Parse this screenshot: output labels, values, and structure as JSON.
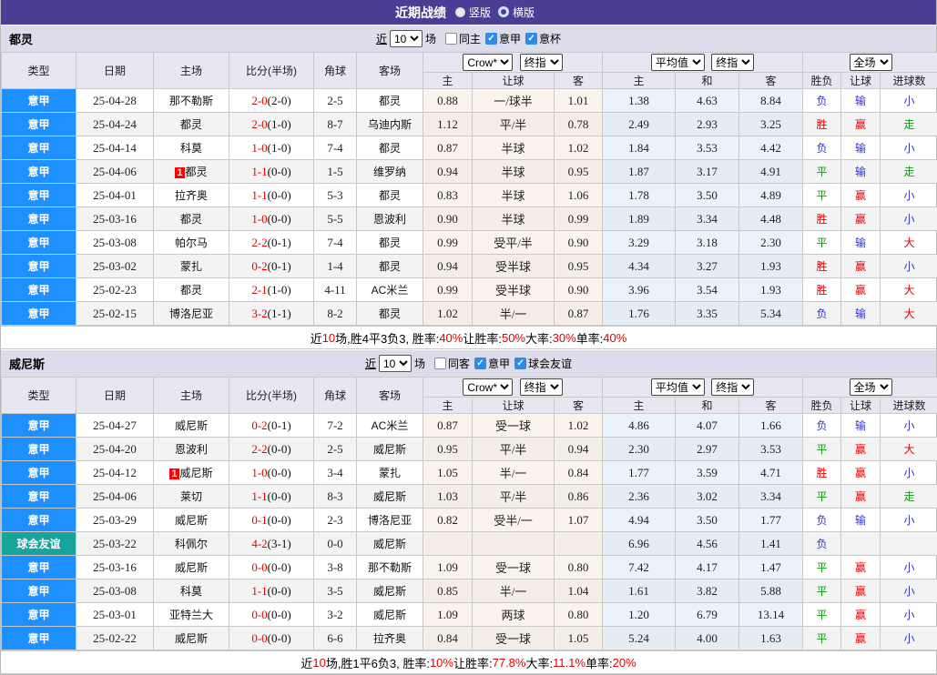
{
  "colors": {
    "title_bar_bg": "#4a3e94",
    "league_blue": "#1e90ff",
    "friendly_teal": "#18a39b",
    "team_green": "#2ba02b",
    "score_red": "#e60000",
    "odds_bg": "#faf4ec",
    "avg_bg": "#eaf3fa",
    "outcome": {
      "胜": "#e60000",
      "平": "#089e08",
      "负": "#3333cc",
      "赢": "#e60000",
      "输": "#3333cc",
      "走": "#089e08",
      "大": "#e60000",
      "小": "#3333cc"
    }
  },
  "title_bar": {
    "title": "近期战绩",
    "radios": [
      {
        "label": "竖版",
        "selected": true
      },
      {
        "label": "横版",
        "selected": false
      }
    ]
  },
  "table_header": {
    "cols": [
      "类型",
      "日期",
      "主场",
      "比分(半场)",
      "角球",
      "客场"
    ],
    "odds_group": {
      "dropdown1": "Crow*",
      "dropdown2": "终指",
      "subcols": [
        "主",
        "让球",
        "客"
      ]
    },
    "avg_group": {
      "dropdown1": "平均值",
      "dropdown2": "终指",
      "subcols": [
        "主",
        "和",
        "客"
      ]
    },
    "result_group": {
      "dropdown": "全场",
      "subcols": [
        "胜负",
        "让球",
        "进球数"
      ]
    }
  },
  "sections": [
    {
      "team": "都灵",
      "filter": {
        "near_label": "近",
        "count": "10",
        "unit_label": "场",
        "checkboxes": [
          {
            "label": "同主",
            "checked": false
          },
          {
            "label": "意甲",
            "checked": true
          },
          {
            "label": "意杯",
            "checked": true
          }
        ]
      },
      "rows": [
        {
          "league": "意甲",
          "league_bg": "#1e90ff",
          "date": "25-04-28",
          "home": "那不勒斯",
          "home_badge": "",
          "home_green": false,
          "score": "2-0",
          "half": "(2-0)",
          "corner": "2-5",
          "away": "都灵",
          "away_green": true,
          "odds_home": "0.88",
          "handicap": "一/球半",
          "odds_away": "1.01",
          "avg_home": "1.38",
          "avg_draw": "4.63",
          "avg_away": "8.84",
          "result": "负",
          "handicap_result": "输",
          "goal_result": "小"
        },
        {
          "league": "意甲",
          "league_bg": "#1e90ff",
          "date": "25-04-24",
          "home": "都灵",
          "home_badge": "",
          "home_green": true,
          "score": "2-0",
          "half": "(1-0)",
          "corner": "8-7",
          "away": "乌迪内斯",
          "away_green": false,
          "odds_home": "1.12",
          "handicap": "平/半",
          "odds_away": "0.78",
          "avg_home": "2.49",
          "avg_draw": "2.93",
          "avg_away": "3.25",
          "result": "胜",
          "handicap_result": "赢",
          "goal_result": "走"
        },
        {
          "league": "意甲",
          "league_bg": "#1e90ff",
          "date": "25-04-14",
          "home": "科莫",
          "home_badge": "",
          "home_green": false,
          "score": "1-0",
          "half": "(1-0)",
          "corner": "7-4",
          "away": "都灵",
          "away_green": true,
          "odds_home": "0.87",
          "handicap": "半球",
          "odds_away": "1.02",
          "avg_home": "1.84",
          "avg_draw": "3.53",
          "avg_away": "4.42",
          "result": "负",
          "handicap_result": "输",
          "goal_result": "小"
        },
        {
          "league": "意甲",
          "league_bg": "#1e90ff",
          "date": "25-04-06",
          "home": "都灵",
          "home_badge": "1",
          "home_green": true,
          "score": "1-1",
          "half": "(0-0)",
          "corner": "1-5",
          "away": "维罗纳",
          "away_green": false,
          "odds_home": "0.94",
          "handicap": "半球",
          "odds_away": "0.95",
          "avg_home": "1.87",
          "avg_draw": "3.17",
          "avg_away": "4.91",
          "result": "平",
          "handicap_result": "输",
          "goal_result": "走"
        },
        {
          "league": "意甲",
          "league_bg": "#1e90ff",
          "date": "25-04-01",
          "home": "拉齐奥",
          "home_badge": "",
          "home_green": false,
          "score": "1-1",
          "half": "(0-0)",
          "corner": "5-3",
          "away": "都灵",
          "away_green": true,
          "odds_home": "0.83",
          "handicap": "半球",
          "odds_away": "1.06",
          "avg_home": "1.78",
          "avg_draw": "3.50",
          "avg_away": "4.89",
          "result": "平",
          "handicap_result": "赢",
          "goal_result": "小"
        },
        {
          "league": "意甲",
          "league_bg": "#1e90ff",
          "date": "25-03-16",
          "home": "都灵",
          "home_badge": "",
          "home_green": true,
          "score": "1-0",
          "half": "(0-0)",
          "corner": "5-5",
          "away": "恩波利",
          "away_green": false,
          "odds_home": "0.90",
          "handicap": "半球",
          "odds_away": "0.99",
          "avg_home": "1.89",
          "avg_draw": "3.34",
          "avg_away": "4.48",
          "result": "胜",
          "handicap_result": "赢",
          "goal_result": "小"
        },
        {
          "league": "意甲",
          "league_bg": "#1e90ff",
          "date": "25-03-08",
          "home": "帕尔马",
          "home_badge": "",
          "home_green": false,
          "score": "2-2",
          "half": "(0-1)",
          "corner": "7-4",
          "away": "都灵",
          "away_green": true,
          "odds_home": "0.99",
          "handicap": "受平/半",
          "odds_away": "0.90",
          "avg_home": "3.29",
          "avg_draw": "3.18",
          "avg_away": "2.30",
          "result": "平",
          "handicap_result": "输",
          "goal_result": "大"
        },
        {
          "league": "意甲",
          "league_bg": "#1e90ff",
          "date": "25-03-02",
          "home": "蒙扎",
          "home_badge": "",
          "home_green": false,
          "score": "0-2",
          "half": "(0-1)",
          "corner": "1-4",
          "away": "都灵",
          "away_green": true,
          "odds_home": "0.94",
          "handicap": "受半球",
          "odds_away": "0.95",
          "avg_home": "4.34",
          "avg_draw": "3.27",
          "avg_away": "1.93",
          "result": "胜",
          "handicap_result": "赢",
          "goal_result": "小"
        },
        {
          "league": "意甲",
          "league_bg": "#1e90ff",
          "date": "25-02-23",
          "home": "都灵",
          "home_badge": "",
          "home_green": true,
          "score": "2-1",
          "half": "(1-0)",
          "corner": "4-11",
          "away": "AC米兰",
          "away_green": false,
          "odds_home": "0.99",
          "handicap": "受半球",
          "odds_away": "0.90",
          "avg_home": "3.96",
          "avg_draw": "3.54",
          "avg_away": "1.93",
          "result": "胜",
          "handicap_result": "赢",
          "goal_result": "大"
        },
        {
          "league": "意甲",
          "league_bg": "#1e90ff",
          "date": "25-02-15",
          "home": "博洛尼亚",
          "home_badge": "",
          "home_green": false,
          "score": "3-2",
          "half": "(1-1)",
          "corner": "8-2",
          "away": "都灵",
          "away_green": true,
          "odds_home": "1.02",
          "handicap": "半/一",
          "odds_away": "0.87",
          "avg_home": "1.76",
          "avg_draw": "3.35",
          "avg_away": "5.34",
          "result": "负",
          "handicap_result": "输",
          "goal_result": "大"
        }
      ],
      "summary": [
        {
          "text": "近"
        },
        {
          "text": "10",
          "red": true
        },
        {
          "text": "场,胜4平3负3, 胜率:"
        },
        {
          "text": "40%",
          "red": true
        },
        {
          "text": " 让胜率:"
        },
        {
          "text": "50%",
          "red": true
        },
        {
          "text": " 大率:"
        },
        {
          "text": "30%",
          "red": true
        },
        {
          "text": " 单率:"
        },
        {
          "text": "40%",
          "red": true
        }
      ]
    },
    {
      "team": "威尼斯",
      "filter": {
        "near_label": "近",
        "count": "10",
        "unit_label": "场",
        "checkboxes": [
          {
            "label": "同客",
            "checked": false
          },
          {
            "label": "意甲",
            "checked": true
          },
          {
            "label": "球会友谊",
            "checked": true
          }
        ]
      },
      "rows": [
        {
          "league": "意甲",
          "league_bg": "#1e90ff",
          "date": "25-04-27",
          "home": "威尼斯",
          "home_badge": "",
          "home_green": true,
          "score": "0-2",
          "half": "(0-1)",
          "corner": "7-2",
          "away": "AC米兰",
          "away_green": false,
          "odds_home": "0.87",
          "handicap": "受一球",
          "odds_away": "1.02",
          "avg_home": "4.86",
          "avg_draw": "4.07",
          "avg_away": "1.66",
          "result": "负",
          "handicap_result": "输",
          "goal_result": "小"
        },
        {
          "league": "意甲",
          "league_bg": "#1e90ff",
          "date": "25-04-20",
          "home": "恩波利",
          "home_badge": "",
          "home_green": false,
          "score": "2-2",
          "half": "(0-0)",
          "corner": "2-5",
          "away": "威尼斯",
          "away_green": true,
          "odds_home": "0.95",
          "handicap": "平/半",
          "odds_away": "0.94",
          "avg_home": "2.30",
          "avg_draw": "2.97",
          "avg_away": "3.53",
          "result": "平",
          "handicap_result": "赢",
          "goal_result": "大"
        },
        {
          "league": "意甲",
          "league_bg": "#1e90ff",
          "date": "25-04-12",
          "home": "威尼斯",
          "home_badge": "1",
          "home_green": true,
          "score": "1-0",
          "half": "(0-0)",
          "corner": "3-4",
          "away": "蒙扎",
          "away_green": false,
          "odds_home": "1.05",
          "handicap": "半/一",
          "odds_away": "0.84",
          "avg_home": "1.77",
          "avg_draw": "3.59",
          "avg_away": "4.71",
          "result": "胜",
          "handicap_result": "赢",
          "goal_result": "小"
        },
        {
          "league": "意甲",
          "league_bg": "#1e90ff",
          "date": "25-04-06",
          "home": "莱切",
          "home_badge": "",
          "home_green": false,
          "score": "1-1",
          "half": "(0-0)",
          "corner": "8-3",
          "away": "威尼斯",
          "away_green": true,
          "odds_home": "1.03",
          "handicap": "平/半",
          "odds_away": "0.86",
          "avg_home": "2.36",
          "avg_draw": "3.02",
          "avg_away": "3.34",
          "result": "平",
          "handicap_result": "赢",
          "goal_result": "走"
        },
        {
          "league": "意甲",
          "league_bg": "#1e90ff",
          "date": "25-03-29",
          "home": "威尼斯",
          "home_badge": "",
          "home_green": true,
          "score": "0-1",
          "half": "(0-0)",
          "corner": "2-3",
          "away": "博洛尼亚",
          "away_green": false,
          "odds_home": "0.82",
          "handicap": "受半/一",
          "odds_away": "1.07",
          "avg_home": "4.94",
          "avg_draw": "3.50",
          "avg_away": "1.77",
          "result": "负",
          "handicap_result": "输",
          "goal_result": "小"
        },
        {
          "league": "球会友谊",
          "league_bg": "#18a39b",
          "date": "25-03-22",
          "home": "科佩尔",
          "home_badge": "",
          "home_green": false,
          "score": "4-2",
          "half": "(3-1)",
          "corner": "0-0",
          "away": "威尼斯",
          "away_green": true,
          "odds_home": "",
          "handicap": "",
          "odds_away": "",
          "avg_home": "6.96",
          "avg_draw": "4.56",
          "avg_away": "1.41",
          "result": "负",
          "handicap_result": "",
          "goal_result": ""
        },
        {
          "league": "意甲",
          "league_bg": "#1e90ff",
          "date": "25-03-16",
          "home": "威尼斯",
          "home_badge": "",
          "home_green": true,
          "score": "0-0",
          "half": "(0-0)",
          "corner": "3-8",
          "away": "那不勒斯",
          "away_green": false,
          "odds_home": "1.09",
          "handicap": "受一球",
          "odds_away": "0.80",
          "avg_home": "7.42",
          "avg_draw": "4.17",
          "avg_away": "1.47",
          "result": "平",
          "handicap_result": "赢",
          "goal_result": "小"
        },
        {
          "league": "意甲",
          "league_bg": "#1e90ff",
          "date": "25-03-08",
          "home": "科莫",
          "home_badge": "",
          "home_green": false,
          "score": "1-1",
          "half": "(0-0)",
          "corner": "3-5",
          "away": "威尼斯",
          "away_green": true,
          "odds_home": "0.85",
          "handicap": "半/一",
          "odds_away": "1.04",
          "avg_home": "1.61",
          "avg_draw": "3.82",
          "avg_away": "5.88",
          "result": "平",
          "handicap_result": "赢",
          "goal_result": "小"
        },
        {
          "league": "意甲",
          "league_bg": "#1e90ff",
          "date": "25-03-01",
          "home": "亚特兰大",
          "home_badge": "",
          "home_green": false,
          "score": "0-0",
          "half": "(0-0)",
          "corner": "3-2",
          "away": "威尼斯",
          "away_green": true,
          "odds_home": "1.09",
          "handicap": "两球",
          "odds_away": "0.80",
          "avg_home": "1.20",
          "avg_draw": "6.79",
          "avg_away": "13.14",
          "result": "平",
          "handicap_result": "赢",
          "goal_result": "小"
        },
        {
          "league": "意甲",
          "league_bg": "#1e90ff",
          "date": "25-02-22",
          "home": "威尼斯",
          "home_badge": "",
          "home_green": true,
          "score": "0-0",
          "half": "(0-0)",
          "corner": "6-6",
          "away": "拉齐奥",
          "away_green": false,
          "odds_home": "0.84",
          "handicap": "受一球",
          "odds_away": "1.05",
          "avg_home": "5.24",
          "avg_draw": "4.00",
          "avg_away": "1.63",
          "result": "平",
          "handicap_result": "赢",
          "goal_result": "小"
        }
      ],
      "summary": [
        {
          "text": "近"
        },
        {
          "text": "10",
          "red": true
        },
        {
          "text": "场,胜1平6负3, 胜率:"
        },
        {
          "text": "10%",
          "red": true
        },
        {
          "text": " 让胜率:"
        },
        {
          "text": "77.8%",
          "red": true
        },
        {
          "text": " 大率:"
        },
        {
          "text": "11.1%",
          "red": true
        },
        {
          "text": " 单率:"
        },
        {
          "text": "20%",
          "red": true
        }
      ]
    }
  ]
}
